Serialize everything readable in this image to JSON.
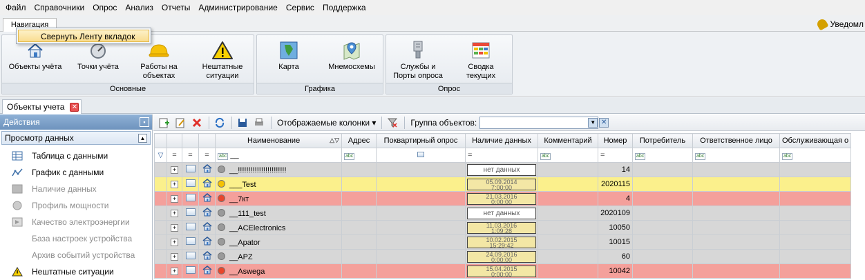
{
  "menu": [
    "Файл",
    "Справочники",
    "Опрос",
    "Анализ",
    "Отчеты",
    "Администрирование",
    "Сервис",
    "Поддержка"
  ],
  "ribbon": {
    "active_tab": "Навигация",
    "notifications": "Уведомл",
    "popup_item": "Свернуть Ленту вкладок",
    "groups": [
      {
        "label": "Основные",
        "buttons": [
          "Объекты учёта",
          "Точки учёта",
          "Работы на\nобъектах",
          "Нештатные\nситуации"
        ]
      },
      {
        "label": "Графика",
        "buttons": [
          "Карта",
          "Мнемосхемы"
        ]
      },
      {
        "label": "Опрос",
        "buttons": [
          "Службы и\nПорты опроса",
          "Сводка\nтекущих"
        ]
      }
    ]
  },
  "doc_tab": "Объекты учета",
  "left_panel": {
    "header": "Действия",
    "section": "Просмотр данных",
    "items": [
      {
        "label": "Таблица с данными",
        "icon": "table-icon",
        "enabled": true
      },
      {
        "label": "График с данными",
        "icon": "graph-icon",
        "enabled": true
      },
      {
        "label": "Наличие данных",
        "icon": "data-presence-icon",
        "enabled": false
      },
      {
        "label": "Профиль мощности",
        "icon": "power-profile-icon",
        "enabled": false
      },
      {
        "label": "Качество электроэнергии",
        "icon": "quality-icon",
        "enabled": false
      },
      {
        "label": "База настроек устройства",
        "icon": "",
        "enabled": false
      },
      {
        "label": "Архив событий устройства",
        "icon": "",
        "enabled": false
      },
      {
        "label": "Нештатные ситуации",
        "icon": "warning-icon",
        "enabled": true
      }
    ]
  },
  "toolbar": {
    "columns_label": "Отображаемые колонки",
    "group_label": "Группа объектов:",
    "group_value": ""
  },
  "grid": {
    "columns": [
      "Наименование",
      "Адрес",
      "Поквартирный опрос",
      "Наличие данных",
      "Комментарий",
      "Номер",
      "Потребитель",
      "Ответственное лицо",
      "Обслуживающая о"
    ],
    "filter_name": "__",
    "rows": [
      {
        "name": "__!!!!!!!!!!!!!!!!!!!!!!!",
        "data": "нет данных",
        "number": "14",
        "status": "gray",
        "dot": "gray"
      },
      {
        "name": "___Test",
        "data": "05.09.2014\n7:00:00",
        "number": "2020115",
        "status": "yellow",
        "dot": "yellow"
      },
      {
        "name": "__7кт",
        "data": "21.03.2016\n0:00:00",
        "number": "4",
        "status": "red",
        "dot": "red"
      },
      {
        "name": "__111_test",
        "data": "нет данных",
        "number": "2020109",
        "status": "gray",
        "dot": "gray"
      },
      {
        "name": "__ACElectronics",
        "data": "11.03.2016\n1:09:28",
        "number": "10050",
        "status": "gray",
        "dot": "gray"
      },
      {
        "name": "__Apator",
        "data": "10.02.2015\n15:29:42",
        "number": "10015",
        "status": "gray",
        "dot": "gray"
      },
      {
        "name": "__APZ",
        "data": "24.09.2016\n0:00:00",
        "number": "60",
        "status": "gray",
        "dot": "gray"
      },
      {
        "name": "__Aswega",
        "data": "15.04.2015\n0:00:00",
        "number": "10042",
        "status": "red",
        "dot": "red"
      }
    ]
  },
  "colors": {
    "row_gray": "#d7d7d7",
    "row_yellow": "#fbf08c",
    "row_red": "#f4a09b",
    "dot_yellow": "#f5c200",
    "dot_red": "#e8462b",
    "dot_gray": "#9a9a9a"
  }
}
